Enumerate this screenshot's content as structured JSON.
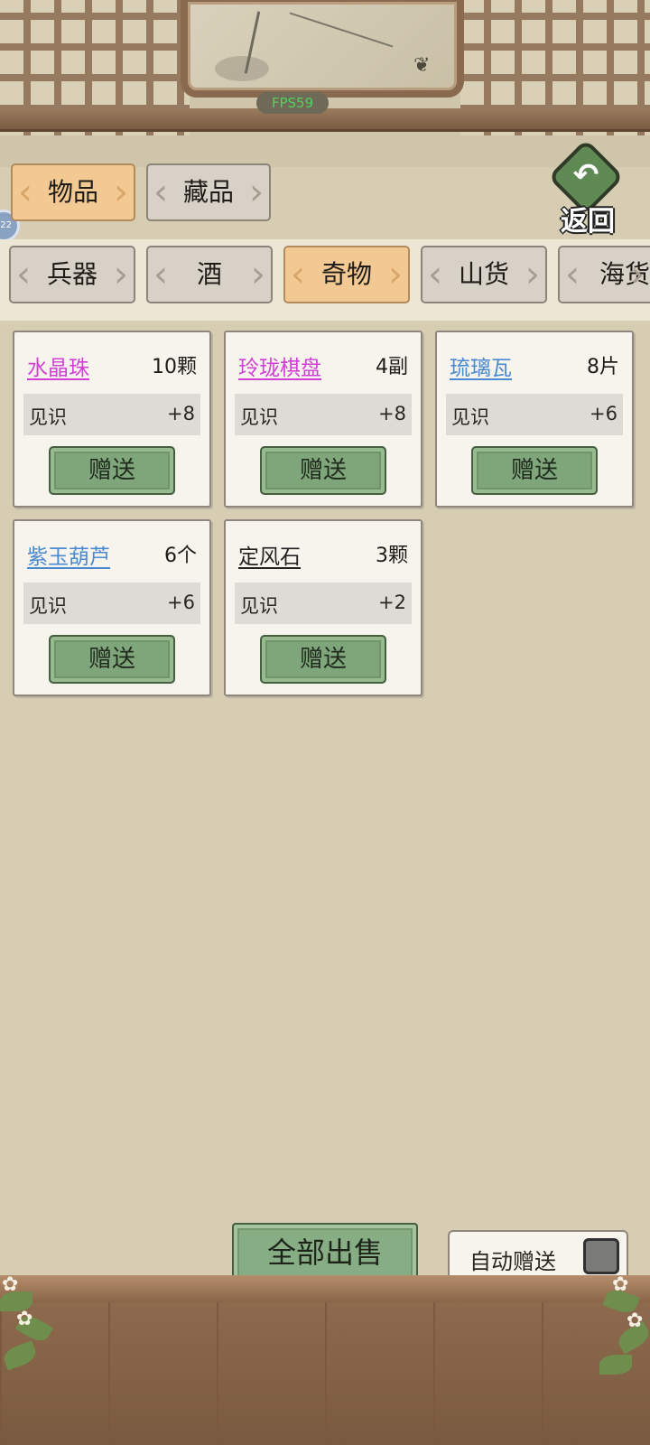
{
  "top": {
    "fps": "FPS59",
    "back_label": "返回",
    "back_arrow": "↶"
  },
  "left_bubble": "22",
  "main_tabs": [
    {
      "label": "物品",
      "active": true
    },
    {
      "label": "藏品",
      "active": false
    }
  ],
  "sub_tabs": [
    {
      "label": "兵器",
      "active": false
    },
    {
      "label": "酒",
      "active": false
    },
    {
      "label": "奇物",
      "active": true
    },
    {
      "label": "山货",
      "active": false
    },
    {
      "label": "海货",
      "active": false
    }
  ],
  "items": [
    {
      "name": "水晶珠",
      "quantity": "10颗",
      "stat_label": "见识",
      "stat_value": "+8",
      "button": "赠送",
      "name_color": "#d13fd4"
    },
    {
      "name": "玲珑棋盘",
      "quantity": "4副",
      "stat_label": "见识",
      "stat_value": "+8",
      "button": "赠送",
      "name_color": "#d13fd4"
    },
    {
      "name": "琉璃瓦",
      "quantity": "8片",
      "stat_label": "见识",
      "stat_value": "+6",
      "button": "赠送",
      "name_color": "#4a8ad0"
    },
    {
      "name": "紫玉葫芦",
      "quantity": "6个",
      "stat_label": "见识",
      "stat_value": "+6",
      "button": "赠送",
      "name_color": "#4a8ad0"
    },
    {
      "name": "定风石",
      "quantity": "3颗",
      "stat_label": "见识",
      "stat_value": "+2",
      "button": "赠送",
      "name_color": "#222222"
    }
  ],
  "bottom": {
    "sell_all": "全部出售",
    "auto_gift": "自动赠送",
    "auto_gift_checked": false
  }
}
